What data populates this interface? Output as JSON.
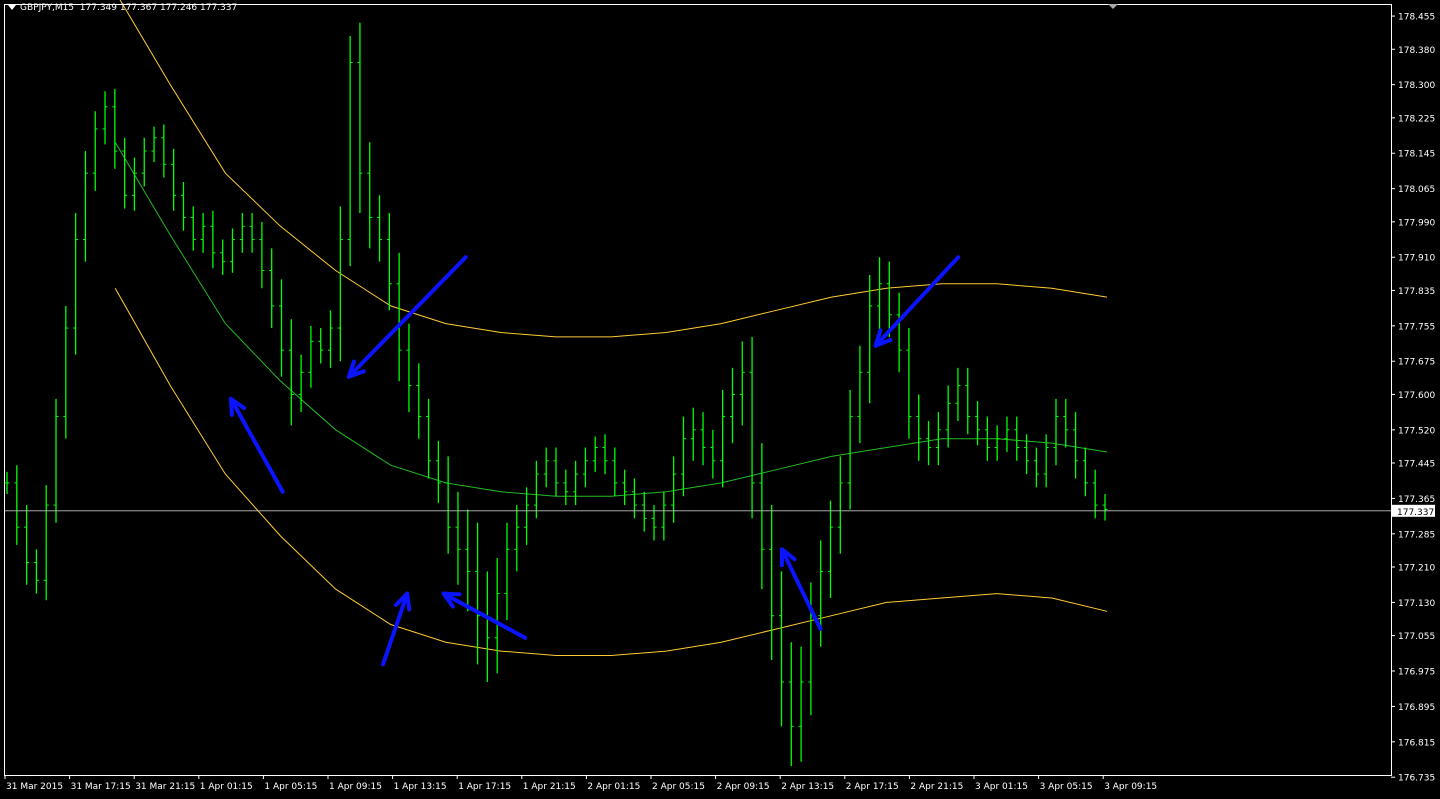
{
  "header": {
    "symbol": "GBPJPY,M15",
    "ohlc": "177.349 177.367 177.246 177.337"
  },
  "colors": {
    "background": "#000000",
    "candles": "#00ff00",
    "envelope": "#ffcc33",
    "midline": "#22bb22",
    "arrows": "#0a14ff",
    "price_line": "#c0c0c0",
    "axis": "#ffffff"
  },
  "chart_data": {
    "type": "line",
    "subtype": "ohlc-bars",
    "title": "GBPJPY,M15",
    "ylim": [
      176.74,
      178.48
    ],
    "grid": false,
    "y_ticks": [
      "178.455",
      "178.380",
      "178.300",
      "178.225",
      "178.145",
      "178.065",
      "177.990",
      "177.910",
      "177.835",
      "177.755",
      "177.675",
      "177.600",
      "177.520",
      "177.445",
      "177.365",
      "177.285",
      "177.210",
      "177.130",
      "177.055",
      "176.975",
      "176.895",
      "176.815",
      "176.735"
    ],
    "x_ticks": [
      "31 Mar 2015",
      "31 Mar 17:15",
      "31 Mar 21:15",
      "1 Apr 01:15",
      "1 Apr 05:15",
      "1 Apr 09:15",
      "1 Apr 13:15",
      "1 Apr 17:15",
      "1 Apr 21:15",
      "2 Apr 01:15",
      "2 Apr 05:15",
      "2 Apr 09:15",
      "2 Apr 13:15",
      "2 Apr 17:15",
      "2 Apr 21:15",
      "3 Apr 01:15",
      "3 Apr 05:15",
      "3 Apr 09:15"
    ],
    "current_price": "177.337",
    "series": [
      {
        "kind": "price",
        "close": [
          177.4,
          177.3,
          177.22,
          177.18,
          177.35,
          177.55,
          177.75,
          177.95,
          178.1,
          178.2,
          178.25,
          178.15,
          178.05,
          178.1,
          178.15,
          178.18,
          178.12,
          178.05,
          178.0,
          177.95,
          177.98,
          177.92,
          177.9,
          177.95,
          177.98,
          177.95,
          177.88,
          177.8,
          177.7,
          177.6,
          177.65,
          177.72,
          177.7,
          177.75,
          177.95,
          178.35,
          178.1,
          178.0,
          177.95,
          177.85,
          177.7,
          177.62,
          177.55,
          177.45,
          177.4,
          177.3,
          177.25,
          177.2,
          177.1,
          177.05,
          177.15,
          177.25,
          177.3,
          177.35,
          177.42,
          177.45,
          177.4,
          177.38,
          177.42,
          177.45,
          177.48,
          177.45,
          177.4,
          177.38,
          177.35,
          177.32,
          177.3,
          177.35,
          177.42,
          177.5,
          177.52,
          177.48,
          177.45,
          177.55,
          177.6,
          177.65,
          177.4,
          177.25,
          177.1,
          176.95,
          176.85,
          176.95,
          177.1,
          177.2,
          177.3,
          177.4,
          177.55,
          177.65,
          177.8,
          177.85,
          177.78,
          177.7,
          177.55,
          177.5,
          177.48,
          177.52,
          177.58,
          177.62,
          177.55,
          177.52,
          177.48,
          177.5,
          177.52,
          177.48,
          177.45,
          177.42,
          177.48,
          177.55,
          177.52,
          177.45,
          177.4,
          177.35,
          177.34
        ],
        "spread": [
          0.05,
          0.08,
          0.1,
          0.06,
          0.09,
          0.08,
          0.1,
          0.12,
          0.1,
          0.08,
          0.07,
          0.08,
          0.06,
          0.07,
          0.06,
          0.05,
          0.06,
          0.07,
          0.06,
          0.05,
          0.06,
          0.07,
          0.06,
          0.05,
          0.06,
          0.06,
          0.08,
          0.1,
          0.12,
          0.14,
          0.08,
          0.07,
          0.06,
          0.08,
          0.15,
          0.12,
          0.18,
          0.14,
          0.1,
          0.12,
          0.14,
          0.12,
          0.1,
          0.08,
          0.09,
          0.12,
          0.16,
          0.18,
          0.22,
          0.2,
          0.16,
          0.12,
          0.1,
          0.08,
          0.06,
          0.06,
          0.06,
          0.06,
          0.06,
          0.06,
          0.05,
          0.06,
          0.06,
          0.06,
          0.06,
          0.06,
          0.06,
          0.06,
          0.08,
          0.1,
          0.1,
          0.08,
          0.08,
          0.12,
          0.12,
          0.14,
          0.16,
          0.18,
          0.2,
          0.2,
          0.18,
          0.16,
          0.15,
          0.14,
          0.12,
          0.12,
          0.12,
          0.12,
          0.14,
          0.12,
          0.1,
          0.1,
          0.1,
          0.1,
          0.08,
          0.08,
          0.08,
          0.08,
          0.08,
          0.07,
          0.06,
          0.06,
          0.06,
          0.06,
          0.06,
          0.06,
          0.06,
          0.08,
          0.08,
          0.08,
          0.06,
          0.06,
          0.05
        ]
      },
      {
        "kind": "envelope-upper",
        "x": [
          0.1,
          0.15,
          0.2,
          0.25,
          0.3,
          0.35,
          0.4,
          0.45,
          0.5,
          0.55,
          0.6,
          0.65,
          0.7,
          0.75,
          0.8,
          0.85,
          0.9,
          0.95,
          1.0
        ],
        "y": [
          178.51,
          178.3,
          178.1,
          177.98,
          177.88,
          177.8,
          177.76,
          177.74,
          177.73,
          177.73,
          177.74,
          177.76,
          177.79,
          177.82,
          177.84,
          177.85,
          177.85,
          177.84,
          177.82
        ]
      },
      {
        "kind": "envelope-lower",
        "x": [
          0.1,
          0.15,
          0.2,
          0.25,
          0.3,
          0.35,
          0.4,
          0.45,
          0.5,
          0.55,
          0.6,
          0.65,
          0.7,
          0.75,
          0.8,
          0.85,
          0.9,
          0.95,
          1.0
        ],
        "y": [
          177.84,
          177.62,
          177.42,
          177.28,
          177.16,
          177.08,
          177.04,
          177.02,
          177.01,
          177.01,
          177.02,
          177.04,
          177.07,
          177.1,
          177.13,
          177.14,
          177.15,
          177.14,
          177.11
        ]
      },
      {
        "kind": "midline",
        "x": [
          0.1,
          0.15,
          0.2,
          0.25,
          0.3,
          0.35,
          0.4,
          0.45,
          0.5,
          0.55,
          0.6,
          0.65,
          0.7,
          0.75,
          0.8,
          0.85,
          0.9,
          0.95,
          1.0
        ],
        "y": [
          178.17,
          177.96,
          177.76,
          177.63,
          177.52,
          177.44,
          177.4,
          177.38,
          177.37,
          177.37,
          177.38,
          177.4,
          177.43,
          177.46,
          177.48,
          177.5,
          177.5,
          177.49,
          177.47
        ]
      }
    ],
    "annotations": [
      {
        "type": "arrow",
        "from": [
          0.252,
          177.38
        ],
        "to": [
          0.205,
          177.59
        ]
      },
      {
        "type": "arrow",
        "from": [
          0.418,
          177.91
        ],
        "to": [
          0.312,
          177.64
        ]
      },
      {
        "type": "arrow",
        "from": [
          0.343,
          176.99
        ],
        "to": [
          0.365,
          177.15
        ]
      },
      {
        "type": "arrow",
        "from": [
          0.472,
          177.05
        ],
        "to": [
          0.398,
          177.15
        ]
      },
      {
        "type": "arrow",
        "from": [
          0.74,
          177.07
        ],
        "to": [
          0.705,
          177.25
        ]
      },
      {
        "type": "arrow",
        "from": [
          0.865,
          177.91
        ],
        "to": [
          0.79,
          177.71
        ]
      }
    ]
  }
}
